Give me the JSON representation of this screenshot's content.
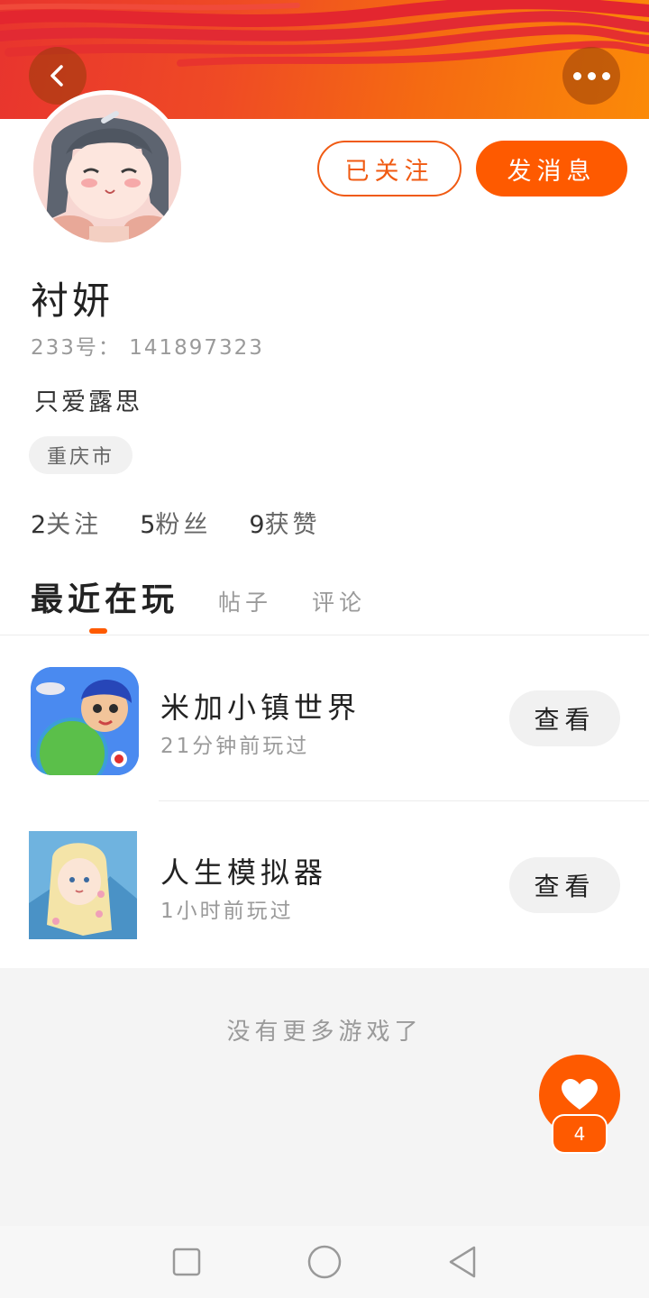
{
  "header": {
    "back_icon": "chevron-left-icon",
    "more_icon": "more-dots-icon",
    "banner_colors": [
      "#e8342e",
      "#fb8a08"
    ]
  },
  "profile": {
    "avatar": "anime-girl-avatar",
    "name": "衬妍",
    "uid": "233号： 141897323",
    "bio": "只爱露思",
    "location": "重庆市",
    "followed_label": "已关注",
    "message_label": "发消息"
  },
  "stats": [
    {
      "num": "2",
      "label": "关注"
    },
    {
      "num": "5",
      "label": "粉丝"
    },
    {
      "num": "9",
      "label": "获赞"
    }
  ],
  "tabs": [
    {
      "label": "最近在玩",
      "active": true
    },
    {
      "label": "帖子",
      "active": false
    },
    {
      "label": "评论",
      "active": false
    }
  ],
  "games": [
    {
      "title": "米加小镇世界",
      "time": "21分钟前玩过",
      "action": "查看",
      "icon": "miga-town-game-icon"
    },
    {
      "title": "人生模拟器",
      "time": "1小时前玩过",
      "action": "查看",
      "icon": "life-simulator-game-icon"
    }
  ],
  "footer": {
    "no_more_text": "没有更多游戏了"
  },
  "like": {
    "icon": "heart-icon",
    "count": "4"
  },
  "navbar": {
    "recent_icon": "square-icon",
    "home_icon": "circle-icon",
    "back_icon": "triangle-back-icon"
  },
  "colors": {
    "accent": "#fe5a00",
    "text_secondary": "#9a9a9a"
  }
}
